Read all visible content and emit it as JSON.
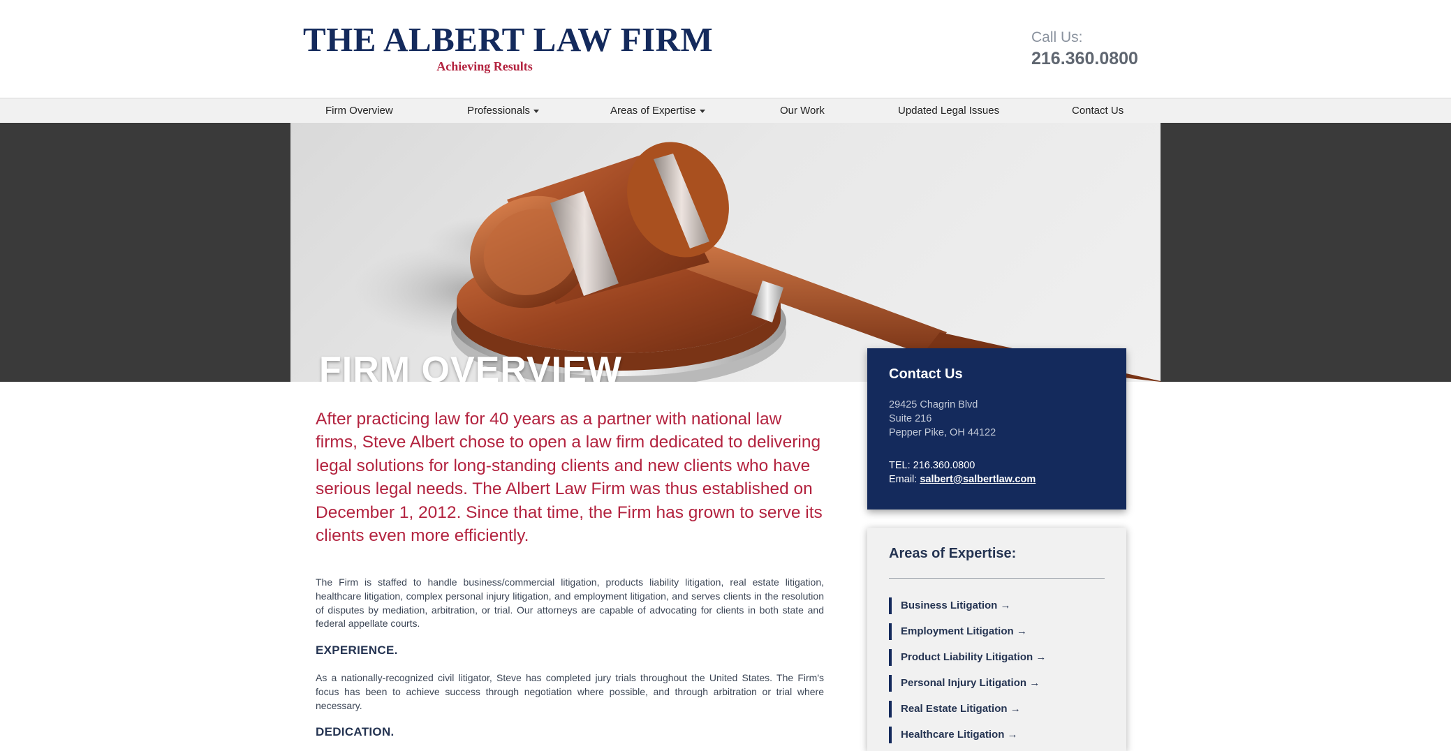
{
  "header": {
    "firm_name": "THE ALBERT LAW FIRM",
    "tagline": "Achieving Results",
    "call_label": "Call Us:",
    "phone": "216.360.0800"
  },
  "nav": {
    "items": [
      {
        "label": "Firm Overview",
        "has_dropdown": false
      },
      {
        "label": "Professionals",
        "has_dropdown": true
      },
      {
        "label": "Areas of Expertise",
        "has_dropdown": true
      },
      {
        "label": "Our Work",
        "has_dropdown": false
      },
      {
        "label": "Updated Legal Issues",
        "has_dropdown": false
      },
      {
        "label": "Contact Us",
        "has_dropdown": false
      }
    ]
  },
  "hero": {
    "title": "FIRM OVERVIEW",
    "image": "gavel-image"
  },
  "main": {
    "intro": "After practicing law for 40 years as a partner with national law firms, Steve Albert chose to open a law firm dedicated to delivering legal solutions for long-standing clients and new clients who have serious legal needs. The Albert Law Firm was thus established on December 1, 2012. Since that time, the Firm has grown to serve its clients even more efficiently.",
    "paragraph1": "The Firm is staffed to handle business/commercial litigation, products liability litigation, real estate litigation, healthcare litigation, complex personal injury litigation, and employment litigation, and serves clients in the resolution of disputes by mediation, arbitration, or trial. Our attorneys are capable of advocating for clients in both state and federal appellate courts.",
    "experience_heading": "EXPERIENCE.",
    "paragraph2": "As a nationally-recognized civil litigator, Steve has completed jury trials throughout the United States. The Firm's focus has been to achieve success through negotiation where possible, and through arbitration or trial where necessary.",
    "dedication_heading": "DEDICATION."
  },
  "contact": {
    "title": "Contact Us",
    "address_line1": "29425 Chagrin Blvd",
    "address_line2": "Suite 216",
    "address_line3": "Pepper Pike, OH 44122",
    "tel": "TEL: 216.360.0800",
    "email_label": "Email: ",
    "email": "salbert@salbertlaw.com"
  },
  "areas": {
    "title": "Areas of Expertise:",
    "items": [
      "Business Litigation →",
      "Employment Litigation →",
      "Product Liability Litigation →",
      "Personal Injury Litigation →",
      "Real Estate Litigation →",
      "Healthcare Litigation →"
    ]
  },
  "colors": {
    "navy": "#142a5c",
    "crimson": "#b3233f",
    "hero_band": "#3a3a3a",
    "nav_bg": "#f1f1f1"
  }
}
